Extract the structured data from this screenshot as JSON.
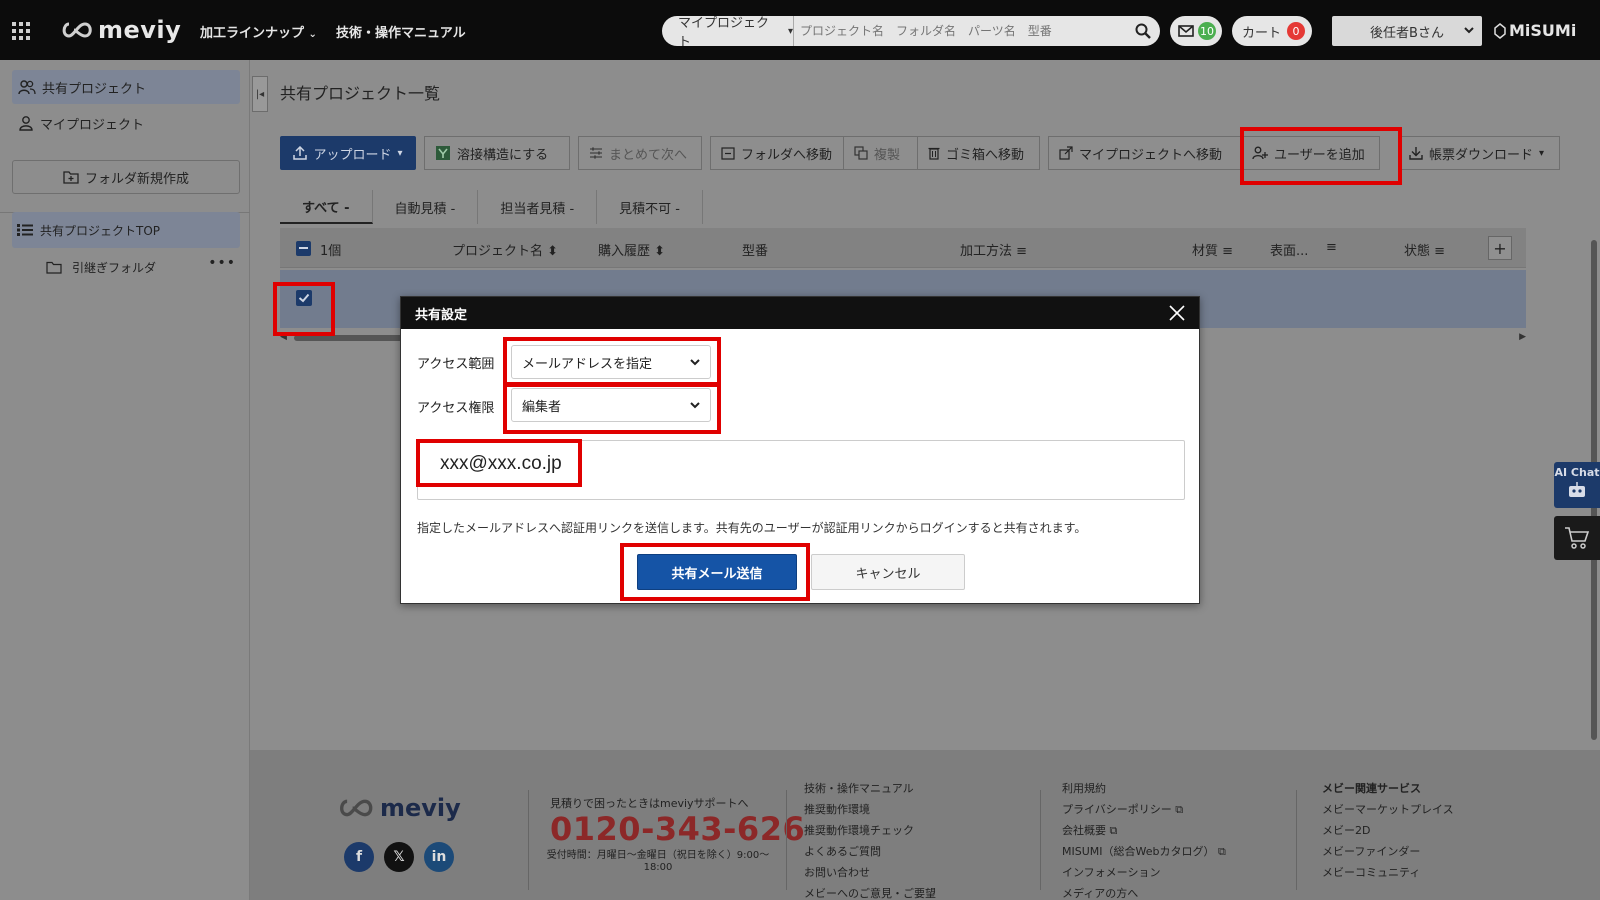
{
  "header": {
    "logo_text": "meviy",
    "nav": [
      "加工ラインナップ",
      "技術・操作マニュアル"
    ],
    "search": {
      "scope": "マイプロジェクト",
      "placeholder": "プロジェクト名　フォルダ名　パーツ名　型番"
    },
    "messages_count": "10",
    "cart_label": "カート",
    "cart_count": "0",
    "user_name": "後任者Bさん",
    "brand": "MiSUMi"
  },
  "sidebar": {
    "shared_projects": "共有プロジェクト",
    "my_projects": "マイプロジェクト",
    "new_folder": "フォルダ新規作成",
    "shared_top": "共有プロジェクトTOP",
    "folder": "引継ぎフォルダ",
    "folder_more": "•••"
  },
  "main": {
    "title": "共有プロジェクト一覧",
    "toolbar": {
      "upload": "アップロード",
      "weld": "溶接構造にする",
      "batch_next": "まとめて次へ",
      "move_folder": "フォルダへ移動",
      "copy": "複製",
      "trash": "ゴミ箱へ移動",
      "move_my": "マイプロジェクトへ移動",
      "add_user": "ユーザーを追加",
      "download": "帳票ダウンロード"
    },
    "tabs": [
      "すべて -",
      "自動見積 -",
      "担当者見積 -",
      "見積不可 -"
    ],
    "table": {
      "selected_count": "1個",
      "columns": [
        "プロジェクト名 ⬍",
        "購入履歴 ⬍",
        "型番",
        "加工方法 ≡",
        "材質 ≡",
        "表面...",
        "≡",
        "状態 ≡"
      ]
    }
  },
  "modal": {
    "title": "共有設定",
    "access_range_label": "アクセス範囲",
    "access_range_value": "メールアドレスを指定",
    "access_perm_label": "アクセス権限",
    "access_perm_value": "編集者",
    "email": "xxx@xxx.co.jp",
    "notice": "指定したメールアドレスへ認証用リンクを送信します。共有先のユーザーが認証用リンクからログインすると共有されます。",
    "send_button": "共有メール送信",
    "cancel_button": "キャンセル"
  },
  "floating": {
    "ai_chat": "AI Chat"
  },
  "footer": {
    "logo_text": "meviy",
    "help_text": "見積りで困ったときはmeviyサポートへ",
    "phone": "0120-343-626",
    "hours": "受付時間：月曜日～金曜日（祝日を除く）9:00～18:00",
    "col1": [
      "技術・操作マニュアル",
      "推奨動作環境",
      "推奨動作環境チェック",
      "よくあるご質問",
      "お問い合わせ",
      "メビーへのご意見・ご要望"
    ],
    "col2": [
      "利用規約",
      "プライバシーポリシー ⧉",
      "会社概要 ⧉",
      "MISUMI（総合Webカタログ） ⧉",
      "インフォメーション",
      "メディアの方へ"
    ],
    "col3_title": "メビー関連サービス",
    "col3": [
      "メビーマーケットプレイス",
      "メビー2D",
      "メビーファインダー",
      "メビーコミュニティ"
    ]
  }
}
